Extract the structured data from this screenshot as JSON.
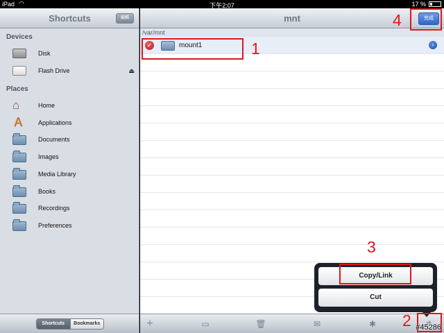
{
  "status_bar": {
    "device": "iPad",
    "time": "下午2:07",
    "battery": "17 %"
  },
  "sidebar": {
    "title": "Shortcuts",
    "edit_label": "編輯",
    "devices_title": "Devices",
    "devices": [
      {
        "label": "Disk",
        "icon": "disk-icon"
      },
      {
        "label": "Flash Drive",
        "icon": "flash-drive-icon"
      }
    ],
    "places_title": "Places",
    "places": [
      {
        "label": "Home",
        "icon": "home-icon"
      },
      {
        "label": "Applications",
        "icon": "applications-icon"
      },
      {
        "label": "Documents",
        "icon": "folder-icon"
      },
      {
        "label": "Images",
        "icon": "folder-icon"
      },
      {
        "label": "Media Library",
        "icon": "folder-icon"
      },
      {
        "label": "Books",
        "icon": "folder-icon"
      },
      {
        "label": "Recordings",
        "icon": "folder-icon"
      },
      {
        "label": "Preferences",
        "icon": "folder-icon"
      }
    ],
    "footer_tabs": {
      "active": "Shortcuts",
      "other": "Bookmarks"
    }
  },
  "main": {
    "title": "mnt",
    "done_label": "完成",
    "path": "/var/mnt",
    "items": [
      {
        "label": "mount1",
        "selected": true
      }
    ]
  },
  "popover": {
    "copy_link": "Copy/Link",
    "cut": "Cut"
  },
  "annotations": {
    "n1": "1",
    "n2": "2",
    "n3": "3",
    "n4": "4"
  },
  "watermark": "#45286",
  "colors": {
    "annotation": "#e0161b",
    "accent": "#2f66c9"
  }
}
